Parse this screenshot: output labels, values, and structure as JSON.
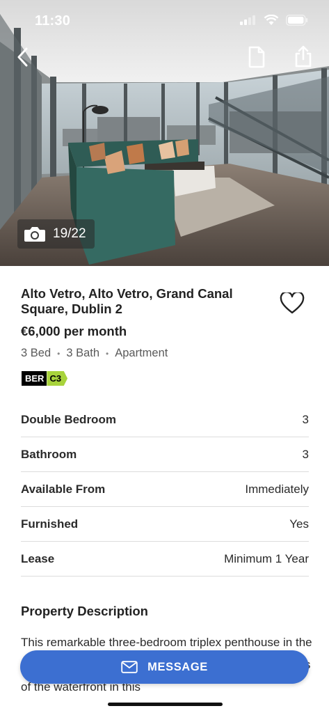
{
  "status_bar": {
    "time": "11:30",
    "icons": [
      "cellular-signal-icon",
      "wifi-icon",
      "battery-icon"
    ]
  },
  "hero": {
    "photo_counter": "19/22",
    "icons": [
      "back-arrow-icon",
      "document-icon",
      "share-icon",
      "camera-icon"
    ]
  },
  "listing": {
    "title": "Alto Vetro, Alto Vetro, Grand Canal Square, Dublin 2",
    "price": "€6,000 per month",
    "beds": "3 Bed",
    "baths": "3 Bath",
    "type": "Apartment",
    "separator": "•",
    "ber_label": "BER",
    "ber_rating": "C3",
    "favorite_icon": "heart-outline-icon"
  },
  "details": [
    {
      "label": "Double Bedroom",
      "value": "3"
    },
    {
      "label": "Bathroom",
      "value": "3"
    },
    {
      "label": "Available From",
      "value": "Immediately"
    },
    {
      "label": "Furnished",
      "value": "Yes"
    },
    {
      "label": "Lease",
      "value": "Minimum 1 Year"
    }
  ],
  "description": {
    "heading": "Property Description",
    "text": "This remarkable three-bedroom triplex penthouse in the award-winning alto vetro, affords you spectacular views of the waterfront in this"
  },
  "actions": {
    "message_label": "MESSAGE",
    "message_icon": "envelope-icon"
  },
  "colors": {
    "accent": "#3c6fd1",
    "ber_green": "#a8d33c",
    "text": "#222222",
    "muted": "#5a5a5a"
  }
}
